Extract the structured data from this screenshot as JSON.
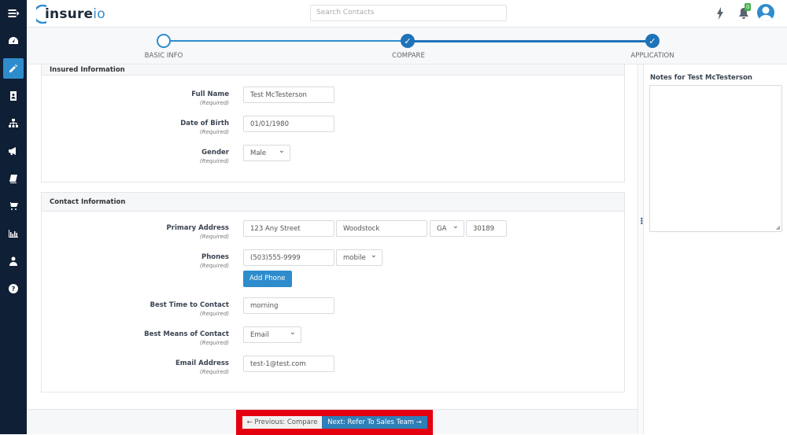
{
  "app": {
    "logo_main": "insure",
    "logo_accent": "io",
    "search_placeholder": "Search Contacts",
    "notification_count": "0"
  },
  "sidebar": {
    "items": [
      {
        "name": "menu-toggle",
        "icon": "menu-icon"
      },
      {
        "name": "dashboard",
        "icon": "dashboard-icon"
      },
      {
        "name": "edit",
        "icon": "pencil-icon",
        "active": true
      },
      {
        "name": "contacts",
        "icon": "contact-card-icon"
      },
      {
        "name": "org-chart",
        "icon": "sitemap-icon"
      },
      {
        "name": "marketing",
        "icon": "megaphone-icon"
      },
      {
        "name": "training",
        "icon": "book-icon"
      },
      {
        "name": "store",
        "icon": "cart-icon"
      },
      {
        "name": "reports",
        "icon": "bar-chart-icon"
      },
      {
        "name": "account",
        "icon": "user-icon"
      },
      {
        "name": "help",
        "icon": "help-icon"
      }
    ]
  },
  "stepper": {
    "steps": [
      {
        "label": "BASIC INFO",
        "state": "current"
      },
      {
        "label": "COMPARE",
        "state": "complete"
      },
      {
        "label": "APPLICATION",
        "state": "complete"
      }
    ]
  },
  "insured": {
    "title": "Insured Information",
    "required": "(Required)",
    "full_name_label": "Full Name",
    "full_name": "Test McTesterson",
    "dob_label": "Date of Birth",
    "dob": "01/01/1980",
    "gender_label": "Gender",
    "gender": "Male"
  },
  "contact": {
    "title": "Contact Information",
    "required": "(Required)",
    "address_label": "Primary Address",
    "street": "123 Any Street",
    "city": "Woodstock",
    "state": "GA",
    "zip": "30189",
    "phones_label": "Phones",
    "phone": "(503)555-9999",
    "phone_type": "mobile",
    "add_phone": "Add Phone",
    "best_time_label": "Best Time to Contact",
    "best_time": "morning",
    "best_means_label": "Best Means of Contact",
    "best_means": "Email",
    "email_label": "Email Address",
    "email": "test-1@test.com"
  },
  "footer": {
    "prev": "← Previous: Compare",
    "next": "Next: Refer To Sales Team →"
  },
  "notes": {
    "title": "Notes for Test McTesterson",
    "value": ""
  },
  "colors": {
    "accent": "#2f8ccc",
    "sidebar": "#0f1f35",
    "highlight": "#e4000f"
  }
}
